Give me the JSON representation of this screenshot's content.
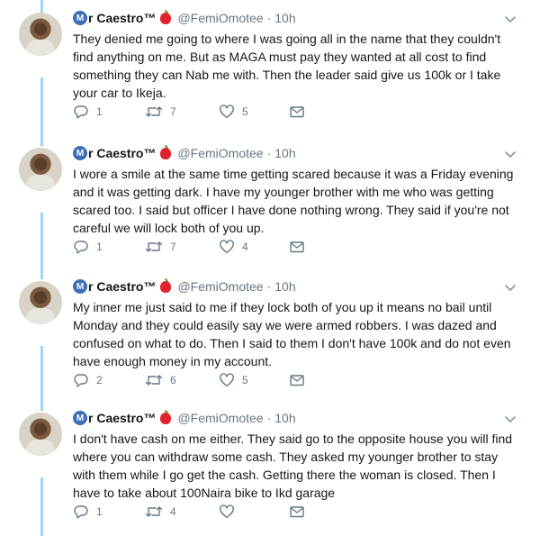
{
  "tweets": [
    {
      "display_name": "r Caestro™",
      "handle": "@FemiOmotee",
      "separator": "·",
      "time": "10h",
      "text": "They denied me going to where I was going all in the name that they couldn't find anything on me. But as MAGA must pay they wanted at all cost to find something they can Nab me with. Then the leader said give us 100k or I take your car to Ikeja.",
      "replies": "1",
      "retweets": "7",
      "likes": "5"
    },
    {
      "display_name": "r Caestro™",
      "handle": "@FemiOmotee",
      "separator": "·",
      "time": "10h",
      "text": "I wore a smile at the same time getting scared because it was a Friday evening and it was getting dark. I have my younger brother with me who was getting scared too. I said but officer I have done nothing wrong. They said if you're not careful we will lock both of you up.",
      "replies": "1",
      "retweets": "7",
      "likes": "4"
    },
    {
      "display_name": "r Caestro™",
      "handle": "@FemiOmotee",
      "separator": "·",
      "time": "10h",
      "text": "My inner me just said to me if they lock both of you up it means no bail until Monday and they could easily say we were armed robbers. I was dazed and confused on what to do. Then I said to them I don't have 100k and do not even have enough money in my account.",
      "replies": "2",
      "retweets": "6",
      "likes": "5"
    },
    {
      "display_name": "r Caestro™",
      "handle": "@FemiOmotee",
      "separator": "·",
      "time": "10h",
      "text": "I don't have cash on me either. They said go to the opposite house you will find where you can withdraw some cash. They asked my younger brother to stay with them while I go get the cash. Getting there the woman is closed. Then I have to take about 100Naira bike to Ikd garage",
      "replies": "1",
      "retweets": "4",
      "likes": ""
    }
  ],
  "logo_letter": "M",
  "icons": {
    "reply": "reply-icon",
    "retweet": "retweet-icon",
    "like": "heart-icon",
    "dm": "envelope-icon",
    "caret": "chevron-down-icon"
  },
  "colors": {
    "thread_line": "#9ad3f4",
    "secondary_text": "#657786",
    "primary_text": "#14171a"
  }
}
